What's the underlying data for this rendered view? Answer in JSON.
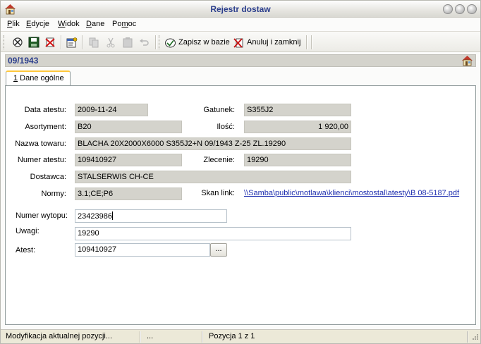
{
  "window": {
    "title": "Rejestr dostaw"
  },
  "menu": [
    {
      "label": "Plik",
      "mnemonic": "P",
      "rest": "lik"
    },
    {
      "label": "Edycje",
      "mnemonic": "E",
      "rest": "dycje"
    },
    {
      "label": "Widok",
      "mnemonic": "W",
      "rest": "idok"
    },
    {
      "label": "Dane",
      "mnemonic": "D",
      "rest": "ane"
    },
    {
      "label": "Pomoc",
      "mnemonic": "m",
      "pre": "Po",
      "rest": "oc"
    }
  ],
  "toolbar": {
    "save_db_label": "Zapisz w bazie",
    "cancel_close_label": "Anuluj i zamknij"
  },
  "document": {
    "number": "09/1943"
  },
  "tabs": [
    {
      "mnemonic": "1",
      "rest": " Dane ogólne"
    }
  ],
  "form": {
    "data_atestu": {
      "label": "Data atestu:",
      "value": "2009-11-24"
    },
    "gatunek": {
      "label": "Gatunek:",
      "value": "S355J2"
    },
    "asortyment": {
      "label": "Asortyment:",
      "value": "B20"
    },
    "ilosc": {
      "label": "Ilość:",
      "value": "1 920,00"
    },
    "nazwa_towaru": {
      "label": "Nazwa towaru:",
      "value": "BLACHA 20X2000X6000 S355J2+N  09/1943 Z-25 ZL.19290"
    },
    "numer_atestu": {
      "label": "Numer atestu:",
      "value": "109410927"
    },
    "zlecenie": {
      "label": "Zlecenie:",
      "value": "19290"
    },
    "dostawca": {
      "label": "Dostawca:",
      "value": "STALSERWIS CH-CE"
    },
    "normy": {
      "label": "Normy:",
      "value": "3.1;CE;P6"
    },
    "skan_link": {
      "label": "Skan link:",
      "value": "\\\\Samba\\public\\motlawa\\klienci\\mostostal\\atesty\\B 08-5187.pdf"
    },
    "numer_wytopu": {
      "label": "Numer wytopu:",
      "value": "23423986"
    },
    "uwagi": {
      "label": "Uwagi:",
      "value": "19290"
    },
    "atest": {
      "label": "Atest:",
      "value": "109410927",
      "button_label": "..."
    }
  },
  "status": {
    "message": "Modyfikacja aktualnej pozycji...",
    "middle": "...",
    "position": "Pozycja 1 z 1"
  },
  "colors": {
    "title_text": "#2b3e8c",
    "link": "#1f2fb0",
    "tab_highlight": "#ffc83c",
    "readonly_bg": "#d4d3cc"
  }
}
